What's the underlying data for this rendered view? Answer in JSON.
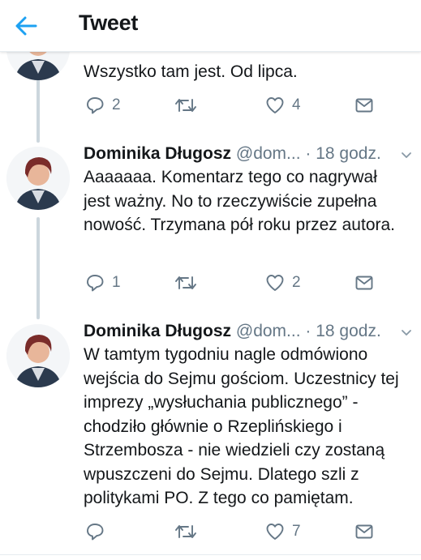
{
  "header": {
    "title": "Tweet"
  },
  "tweets": [
    {
      "text": "Wszystko tam jest. Od lipca.",
      "replies": "2",
      "retweets": "",
      "likes": "4"
    },
    {
      "name": "Dominika Długosz",
      "handle": "@dom...",
      "time": "· 18 godz.",
      "text": "Aaaaaaa. Komentarz tego co nagrywał jest ważny. No to rzeczywiście zupełna nowość. Trzymana pół roku przez autora.",
      "replies": "1",
      "retweets": "",
      "likes": "2"
    },
    {
      "name": "Dominika Długosz",
      "handle": "@dom...",
      "time": "· 18 godz.",
      "text": "W tamtym tygodniu nagle odmówiono wejścia do Sejmu gościom. Uczestnicy tej imprezy „wysłuchania publicznego” - chodziło głównie o Rzeplińskiego i Strzembosza - nie wiedzieli czy zostaną wpuszczeni do Sejmu. Dlatego szli z politykami PO. Z tego co pamiętam.",
      "replies": "",
      "retweets": "",
      "likes": "7"
    }
  ],
  "icons": {
    "back": "arrow-left-icon",
    "reply": "reply-icon",
    "retweet": "retweet-icon",
    "like": "heart-icon",
    "dm": "envelope-icon",
    "menu": "chevron-down-icon"
  },
  "colors": {
    "accent": "#1da1f2",
    "secondary_text": "#657786",
    "thread_line": "#ccd6dd"
  }
}
